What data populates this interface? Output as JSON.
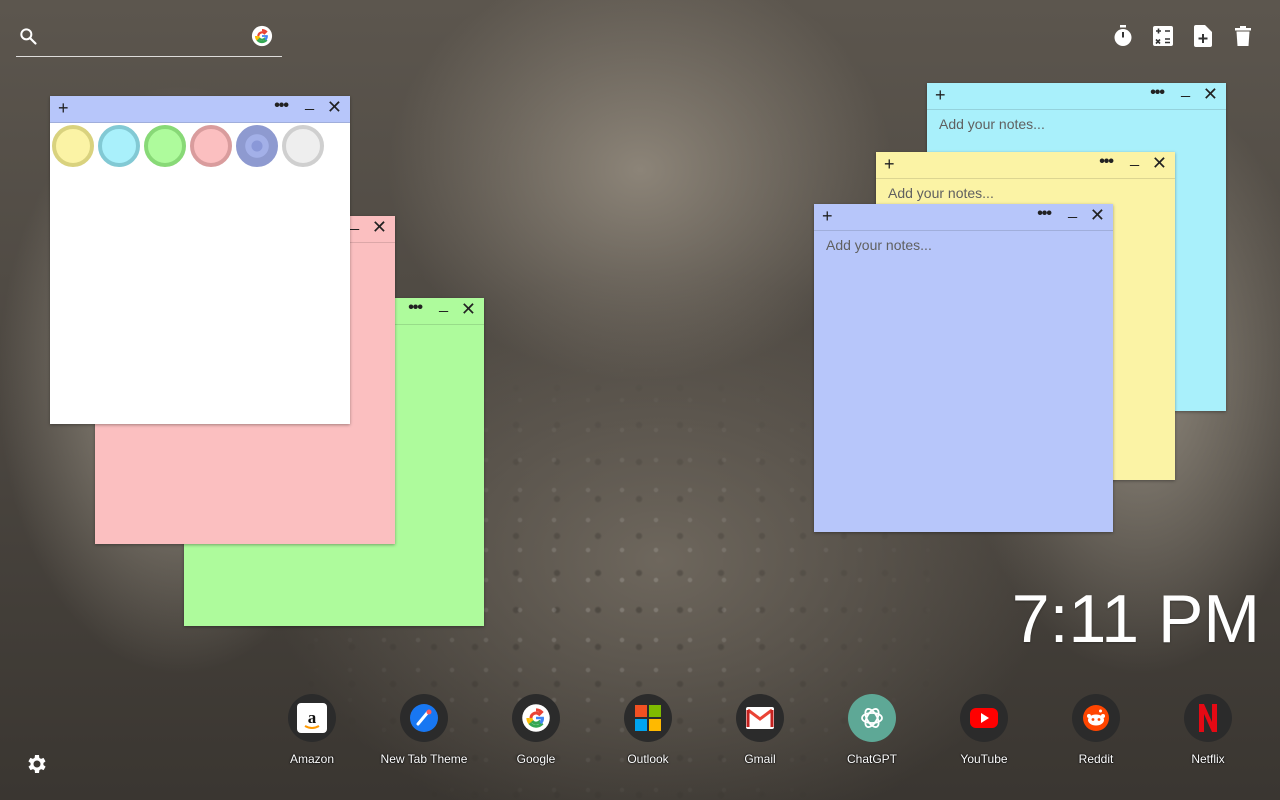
{
  "search": {
    "placeholder": "",
    "value": "",
    "icon": "search-icon",
    "engine_icon": "google-icon"
  },
  "toolbar": {
    "icons": [
      "timer-icon",
      "calculator-icon",
      "add-note-icon",
      "trash-icon"
    ]
  },
  "notes": [
    {
      "color": "#a9f0fb",
      "placeholder": "Add your notes..."
    },
    {
      "color": "#fbf3a5",
      "placeholder": "Add your notes..."
    },
    {
      "color": "#b7c6fa",
      "placeholder": "Add your notes..."
    },
    {
      "color": "#fbbfc0",
      "placeholder": ""
    },
    {
      "color": "#aefb9c",
      "placeholder": ""
    },
    {
      "color": "#ffffff",
      "header_color": "#b7c6fa",
      "placeholder": ""
    }
  ],
  "note_buttons": {
    "add": "+",
    "more": "•••",
    "minimize": "_",
    "close": "✕"
  },
  "palette": {
    "swatches": [
      {
        "name": "yellow",
        "fill": "#fbf3a5",
        "border": "#d9d27e"
      },
      {
        "name": "blue",
        "fill": "#a9f0fb",
        "border": "#82c9d4"
      },
      {
        "name": "green",
        "fill": "#aefb9c",
        "border": "#88d977"
      },
      {
        "name": "pink",
        "fill": "#fbbfc0",
        "border": "#d99c9d"
      },
      {
        "name": "indigo",
        "fill": "#b7c6fa",
        "border": "#8e9ad0",
        "selected": true
      },
      {
        "name": "grey",
        "fill": "#eeeeee",
        "border": "#cfcfcf"
      }
    ]
  },
  "clock": {
    "time": "7:11 PM"
  },
  "shortcuts": [
    {
      "label": "Amazon",
      "icon": "amazon-icon"
    },
    {
      "label": "New Tab Theme",
      "icon": "new-tab-theme-icon"
    },
    {
      "label": "Google",
      "icon": "google-icon"
    },
    {
      "label": "Outlook",
      "icon": "outlook-icon"
    },
    {
      "label": "Gmail",
      "icon": "gmail-icon"
    },
    {
      "label": "ChatGPT",
      "icon": "chatgpt-icon"
    },
    {
      "label": "YouTube",
      "icon": "youtube-icon"
    },
    {
      "label": "Reddit",
      "icon": "reddit-icon"
    },
    {
      "label": "Netflix",
      "icon": "netflix-icon"
    }
  ],
  "settings": {
    "icon": "gear-icon"
  }
}
